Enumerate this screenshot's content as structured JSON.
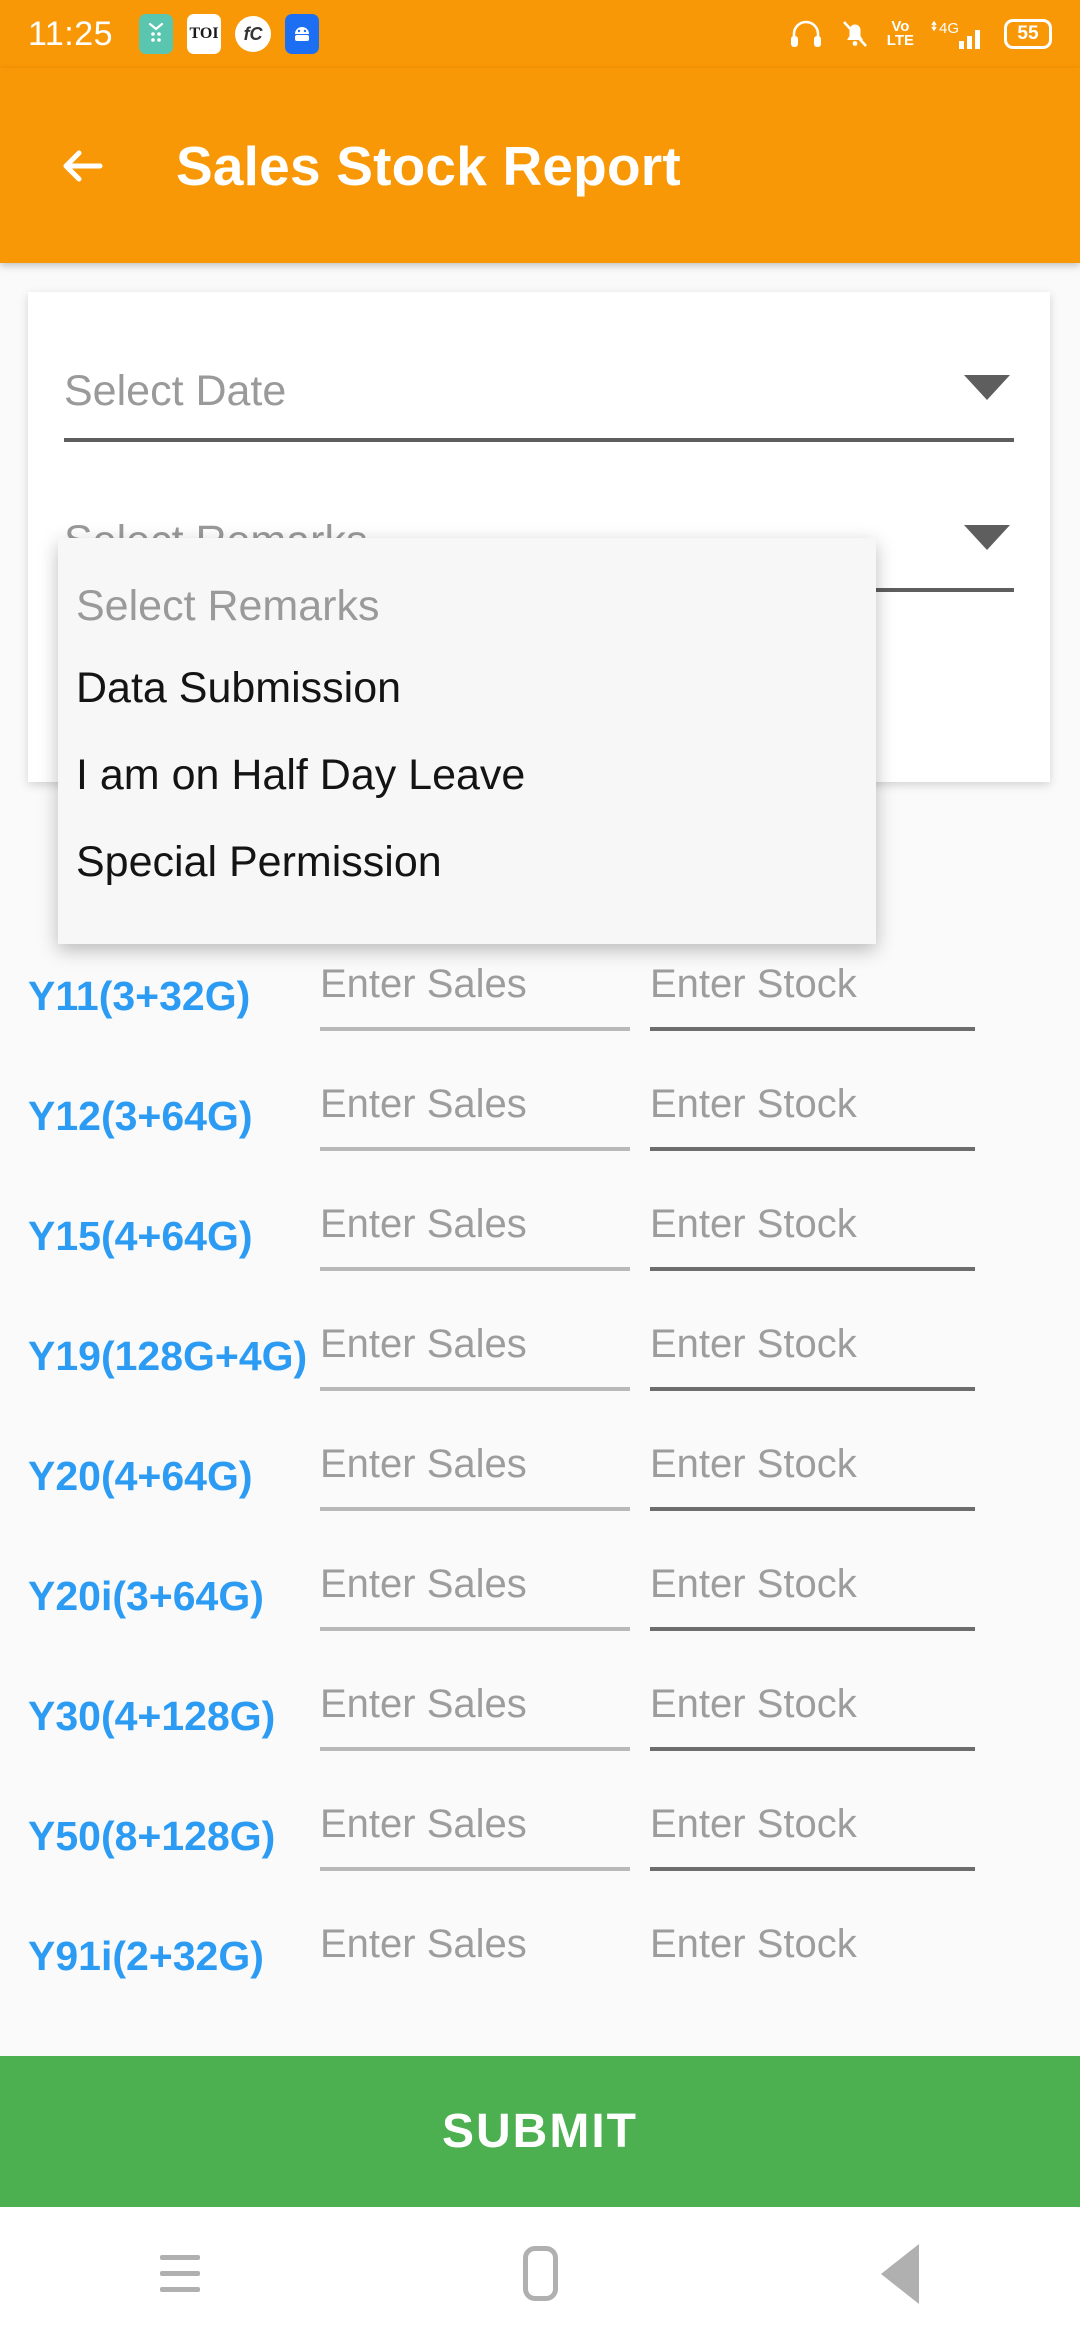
{
  "status_bar": {
    "time": "11:25",
    "left_icons": [
      "app-icon-teal",
      "app-icon-toi",
      "app-icon-fc",
      "app-icon-android"
    ],
    "toi_label": "TOI",
    "fc_label": "fC",
    "right_icons": [
      "headphones-icon",
      "bell-off-icon",
      "volte-icon",
      "signal-4g-icon"
    ],
    "volte_top": "Vo",
    "volte_bottom": "LTE",
    "battery_level": "55"
  },
  "app_bar": {
    "back_icon": "back-arrow-icon",
    "title": "Sales Stock Report",
    "background_color": "#F99806"
  },
  "form": {
    "date_field": {
      "label": "Select Date",
      "caret": "chevron-down-icon"
    },
    "remarks_field": {
      "label": "Select Remarks",
      "caret": "chevron-down-icon"
    }
  },
  "dropdown": {
    "hint": "Select Remarks",
    "options": [
      "Data Submission",
      "I am on Half Day Leave",
      "Special Permission"
    ]
  },
  "product_table": {
    "sales_placeholder": "Enter Sales",
    "stock_placeholder": "Enter Stock",
    "rows": [
      {
        "name": "Y11(3+32G)",
        "sales": "",
        "stock": ""
      },
      {
        "name": "Y12(3+64G)",
        "sales": "",
        "stock": ""
      },
      {
        "name": "Y15(4+64G)",
        "sales": "",
        "stock": ""
      },
      {
        "name": "Y19(128G+4G)",
        "sales": "",
        "stock": ""
      },
      {
        "name": "Y20(4+64G)",
        "sales": "",
        "stock": ""
      },
      {
        "name": "Y20i(3+64G)",
        "sales": "",
        "stock": ""
      },
      {
        "name": "Y30(4+128G)",
        "sales": "",
        "stock": ""
      },
      {
        "name": "Y50(8+128G)",
        "sales": "",
        "stock": ""
      },
      {
        "name": "Y91i(2+32G)",
        "sales": "",
        "stock": ""
      }
    ]
  },
  "submit": {
    "label": "SUBMIT",
    "color": "#4CAF50"
  },
  "nav_bar": {
    "items": [
      "menu-icon",
      "home-icon",
      "back-icon"
    ]
  },
  "colors": {
    "accent_orange": "#F99806",
    "product_blue": "#2B9BF4",
    "submit_green": "#4CAF50"
  }
}
